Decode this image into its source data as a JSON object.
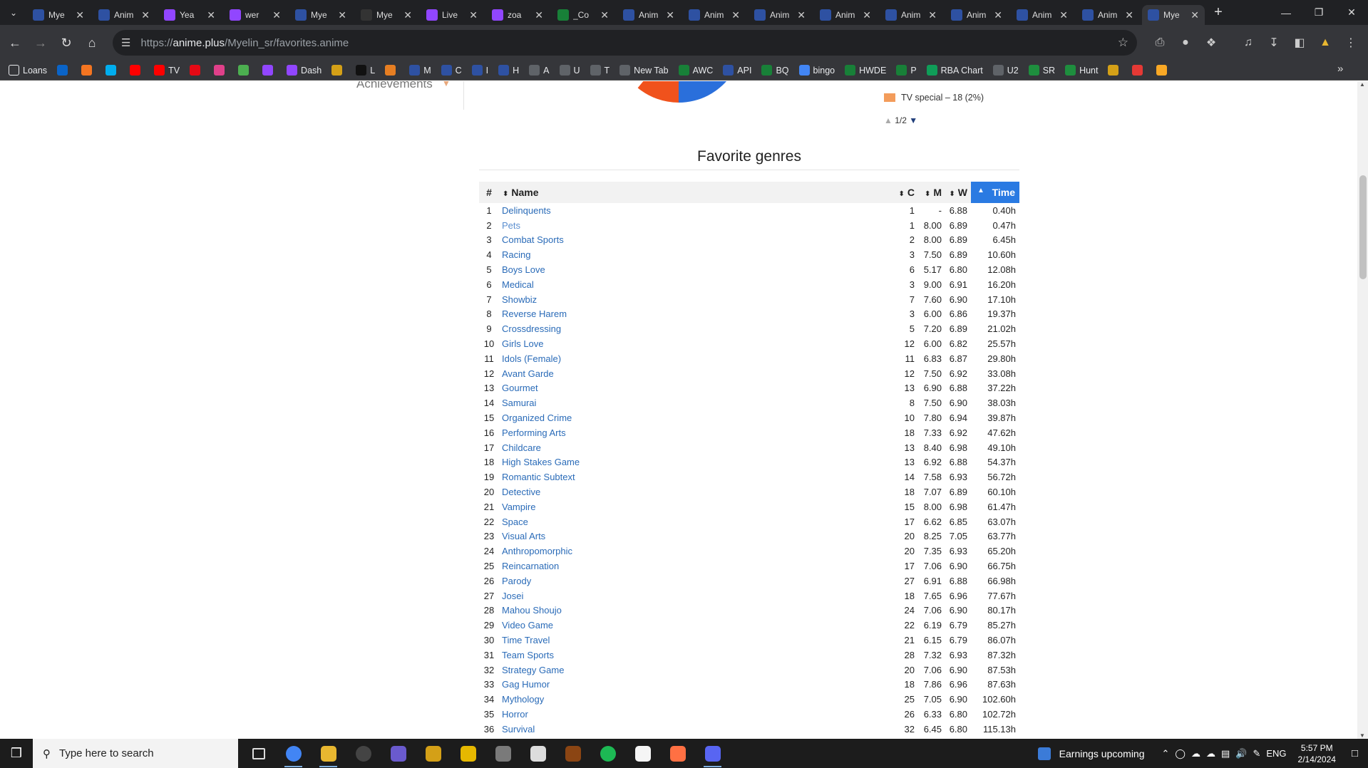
{
  "browser": {
    "tabs": [
      {
        "label": "Mye",
        "icon": "mal-icon",
        "color": "#2e51a2",
        "active": false
      },
      {
        "label": "Anim",
        "icon": "notify-icon",
        "color": "#2e51a2",
        "active": false
      },
      {
        "label": "Yea",
        "icon": "twitch-icon",
        "color": "#9146ff",
        "active": false
      },
      {
        "label": "wer",
        "icon": "twitch-icon",
        "color": "#9146ff",
        "active": false
      },
      {
        "label": "Mye",
        "icon": "mal-icon",
        "color": "#2e51a2",
        "active": false
      },
      {
        "label": "Mye",
        "icon": "anime-plus-icon",
        "color": "#333333",
        "active": false
      },
      {
        "label": "Live",
        "icon": "twitch-icon",
        "color": "#9146ff",
        "active": false
      },
      {
        "label": "zoa",
        "icon": "twitch-icon",
        "color": "#9146ff",
        "active": false
      },
      {
        "label": "_Co",
        "icon": "sheets-icon",
        "color": "#188038",
        "active": false
      },
      {
        "label": "Anim",
        "icon": "notify-icon",
        "color": "#2e51a2",
        "active": false
      },
      {
        "label": "Anim",
        "icon": "notify-icon",
        "color": "#2e51a2",
        "active": false
      },
      {
        "label": "Anim",
        "icon": "notify-icon",
        "color": "#2e51a2",
        "active": false
      },
      {
        "label": "Anim",
        "icon": "notify-icon",
        "color": "#2e51a2",
        "active": false
      },
      {
        "label": "Anim",
        "icon": "notify-icon",
        "color": "#2e51a2",
        "active": false
      },
      {
        "label": "Anim",
        "icon": "notify-icon",
        "color": "#2e51a2",
        "active": false
      },
      {
        "label": "Anim",
        "icon": "notify-icon",
        "color": "#2e51a2",
        "active": false
      },
      {
        "label": "Anim",
        "icon": "notify-icon",
        "color": "#2e51a2",
        "active": false
      },
      {
        "label": "Mye",
        "icon": "mal-icon",
        "color": "#2e51a2",
        "active": true
      }
    ],
    "url_prefix": "https://",
    "url_host": "anime.plus",
    "url_path": "/Myelin_sr/favorites.anime",
    "bookmarks": [
      {
        "label": "Loans",
        "icon": "folder-icon",
        "color": "#35363a"
      },
      {
        "label": "",
        "icon": "outlook-icon",
        "color": "#0a64c8"
      },
      {
        "label": "",
        "icon": "crunchyroll-icon",
        "color": "#f47521"
      },
      {
        "label": "",
        "icon": "hidive-icon",
        "color": "#00aeef"
      },
      {
        "label": "",
        "icon": "youtube-icon",
        "color": "#ff0000"
      },
      {
        "label": "TV",
        "icon": "youtube-tv-icon",
        "color": "#ff0000"
      },
      {
        "label": "",
        "icon": "netflix-icon",
        "color": "#e50914"
      },
      {
        "label": "",
        "icon": "bookmark-icon",
        "color": "#e0408a"
      },
      {
        "label": "",
        "icon": "bookmark-icon",
        "color": "#4caf50"
      },
      {
        "label": "",
        "icon": "twitch-icon",
        "color": "#9146ff"
      },
      {
        "label": "Dash",
        "icon": "twitch-icon",
        "color": "#9146ff"
      },
      {
        "label": "",
        "icon": "trophy-icon",
        "color": "#d4a017"
      },
      {
        "label": "L",
        "icon": "triangle-icon",
        "color": "#111111"
      },
      {
        "label": "",
        "icon": "bookmark-icon",
        "color": "#e67e22"
      },
      {
        "label": "M",
        "icon": "mal-icon",
        "color": "#2e51a2"
      },
      {
        "label": "C",
        "icon": "mal-icon",
        "color": "#2e51a2"
      },
      {
        "label": "I",
        "icon": "mal-icon",
        "color": "#2e51a2"
      },
      {
        "label": "H",
        "icon": "notify-icon",
        "color": "#2e51a2"
      },
      {
        "label": "A",
        "icon": "globe-icon",
        "color": "#5f6368"
      },
      {
        "label": "U",
        "icon": "globe-icon",
        "color": "#5f6368"
      },
      {
        "label": "T",
        "icon": "globe-icon",
        "color": "#5f6368"
      },
      {
        "label": "New Tab",
        "icon": "globe-icon",
        "color": "#5f6368"
      },
      {
        "label": "AWC",
        "icon": "sheets-icon",
        "color": "#188038"
      },
      {
        "label": "API",
        "icon": "mal-icon",
        "color": "#2e51a2"
      },
      {
        "label": "BQ",
        "icon": "sheets-icon",
        "color": "#188038"
      },
      {
        "label": "bingo",
        "icon": "docs-icon",
        "color": "#4285f4"
      },
      {
        "label": "HWDE",
        "icon": "sheets-icon",
        "color": "#188038"
      },
      {
        "label": "P",
        "icon": "sheets-icon",
        "color": "#188038"
      },
      {
        "label": "RBA Chart",
        "icon": "chart-icon",
        "color": "#0f9d58"
      },
      {
        "label": "U2",
        "icon": "globe-icon",
        "color": "#5f6368"
      },
      {
        "label": "SR",
        "icon": "drive-icon",
        "color": "#1e8e3e"
      },
      {
        "label": "Hunt",
        "icon": "drive-icon",
        "color": "#1e8e3e"
      },
      {
        "label": "",
        "icon": "bookmark-icon",
        "color": "#d4a017"
      },
      {
        "label": "",
        "icon": "bookmark-icon",
        "color": "#e53935"
      },
      {
        "label": "",
        "icon": "warning-icon",
        "color": "#f9a825"
      }
    ]
  },
  "page": {
    "sidebar_achievements": "Achievements",
    "legend_label": "TV special – 18 (2%)",
    "legend_color": "#f39c5b",
    "pager_text": "1/2",
    "pie_colors": [
      "#f0521c",
      "#2a6fdb"
    ],
    "section_title": "Favorite genres",
    "headers": {
      "rank": "#",
      "name": "Name",
      "count": "C",
      "mean": "M",
      "weighted": "W",
      "time": "Time"
    },
    "rows": [
      {
        "rank": "1",
        "name": "Delinquents",
        "c": "1",
        "m": "-",
        "w": "6.88",
        "t": "0.40h"
      },
      {
        "rank": "2",
        "name": "Pets",
        "c": "1",
        "m": "8.00",
        "w": "6.89",
        "t": "0.47h"
      },
      {
        "rank": "3",
        "name": "Combat Sports",
        "c": "2",
        "m": "8.00",
        "w": "6.89",
        "t": "6.45h"
      },
      {
        "rank": "4",
        "name": "Racing",
        "c": "3",
        "m": "7.50",
        "w": "6.89",
        "t": "10.60h"
      },
      {
        "rank": "5",
        "name": "Boys Love",
        "c": "6",
        "m": "5.17",
        "w": "6.80",
        "t": "12.08h"
      },
      {
        "rank": "6",
        "name": "Medical",
        "c": "3",
        "m": "9.00",
        "w": "6.91",
        "t": "16.20h"
      },
      {
        "rank": "7",
        "name": "Showbiz",
        "c": "7",
        "m": "7.60",
        "w": "6.90",
        "t": "17.10h"
      },
      {
        "rank": "8",
        "name": "Reverse Harem",
        "c": "3",
        "m": "6.00",
        "w": "6.86",
        "t": "19.37h"
      },
      {
        "rank": "9",
        "name": "Crossdressing",
        "c": "5",
        "m": "7.20",
        "w": "6.89",
        "t": "21.02h"
      },
      {
        "rank": "10",
        "name": "Girls Love",
        "c": "12",
        "m": "6.00",
        "w": "6.82",
        "t": "25.57h"
      },
      {
        "rank": "11",
        "name": "Idols (Female)",
        "c": "11",
        "m": "6.83",
        "w": "6.87",
        "t": "29.80h"
      },
      {
        "rank": "12",
        "name": "Avant Garde",
        "c": "12",
        "m": "7.50",
        "w": "6.92",
        "t": "33.08h"
      },
      {
        "rank": "13",
        "name": "Gourmet",
        "c": "13",
        "m": "6.90",
        "w": "6.88",
        "t": "37.22h"
      },
      {
        "rank": "14",
        "name": "Samurai",
        "c": "8",
        "m": "7.50",
        "w": "6.90",
        "t": "38.03h"
      },
      {
        "rank": "15",
        "name": "Organized Crime",
        "c": "10",
        "m": "7.80",
        "w": "6.94",
        "t": "39.87h"
      },
      {
        "rank": "16",
        "name": "Performing Arts",
        "c": "18",
        "m": "7.33",
        "w": "6.92",
        "t": "47.62h"
      },
      {
        "rank": "17",
        "name": "Childcare",
        "c": "13",
        "m": "8.40",
        "w": "6.98",
        "t": "49.10h"
      },
      {
        "rank": "18",
        "name": "High Stakes Game",
        "c": "13",
        "m": "6.92",
        "w": "6.88",
        "t": "54.37h"
      },
      {
        "rank": "19",
        "name": "Romantic Subtext",
        "c": "14",
        "m": "7.58",
        "w": "6.93",
        "t": "56.72h"
      },
      {
        "rank": "20",
        "name": "Detective",
        "c": "18",
        "m": "7.07",
        "w": "6.89",
        "t": "60.10h"
      },
      {
        "rank": "21",
        "name": "Vampire",
        "c": "15",
        "m": "8.00",
        "w": "6.98",
        "t": "61.47h"
      },
      {
        "rank": "22",
        "name": "Space",
        "c": "17",
        "m": "6.62",
        "w": "6.85",
        "t": "63.07h"
      },
      {
        "rank": "23",
        "name": "Visual Arts",
        "c": "20",
        "m": "8.25",
        "w": "7.05",
        "t": "63.77h"
      },
      {
        "rank": "24",
        "name": "Anthropomorphic",
        "c": "20",
        "m": "7.35",
        "w": "6.93",
        "t": "65.20h"
      },
      {
        "rank": "25",
        "name": "Reincarnation",
        "c": "17",
        "m": "7.06",
        "w": "6.90",
        "t": "66.75h"
      },
      {
        "rank": "26",
        "name": "Parody",
        "c": "27",
        "m": "6.91",
        "w": "6.88",
        "t": "66.98h"
      },
      {
        "rank": "27",
        "name": "Josei",
        "c": "18",
        "m": "7.65",
        "w": "6.96",
        "t": "77.67h"
      },
      {
        "rank": "28",
        "name": "Mahou Shoujo",
        "c": "24",
        "m": "7.06",
        "w": "6.90",
        "t": "80.17h"
      },
      {
        "rank": "29",
        "name": "Video Game",
        "c": "22",
        "m": "6.19",
        "w": "6.79",
        "t": "85.27h"
      },
      {
        "rank": "30",
        "name": "Time Travel",
        "c": "21",
        "m": "6.15",
        "w": "6.79",
        "t": "86.07h"
      },
      {
        "rank": "31",
        "name": "Team Sports",
        "c": "28",
        "m": "7.32",
        "w": "6.93",
        "t": "87.32h"
      },
      {
        "rank": "32",
        "name": "Strategy Game",
        "c": "20",
        "m": "7.06",
        "w": "6.90",
        "t": "87.53h"
      },
      {
        "rank": "33",
        "name": "Gag Humor",
        "c": "18",
        "m": "7.86",
        "w": "6.96",
        "t": "87.63h"
      },
      {
        "rank": "34",
        "name": "Mythology",
        "c": "25",
        "m": "7.05",
        "w": "6.90",
        "t": "102.60h"
      },
      {
        "rank": "35",
        "name": "Horror",
        "c": "26",
        "m": "6.33",
        "w": "6.80",
        "t": "102.72h"
      },
      {
        "rank": "36",
        "name": "Survival",
        "c": "32",
        "m": "6.45",
        "w": "6.80",
        "t": "115.13h"
      }
    ]
  },
  "taskbar": {
    "search_placeholder": "Type here to search",
    "apps": [
      {
        "icon": "task-view-icon",
        "color": "#1c1c1c",
        "running": false
      },
      {
        "icon": "chrome-icon",
        "color": "#4285f4",
        "running": true
      },
      {
        "icon": "file-explorer-icon",
        "color": "#e8b730",
        "running": true
      },
      {
        "icon": "obs-icon",
        "color": "#444444",
        "running": false
      },
      {
        "icon": "davinci-icon",
        "color": "#6a5acd",
        "running": false
      },
      {
        "icon": "game-icon",
        "color": "#d4a017",
        "running": false
      },
      {
        "icon": "sun-icon",
        "color": "#e6b800",
        "running": false
      },
      {
        "icon": "game-icon",
        "color": "#7a7a7a",
        "running": false
      },
      {
        "icon": "save-icon",
        "color": "#dddddd",
        "running": false
      },
      {
        "icon": "game-icon",
        "color": "#8b4513",
        "running": false
      },
      {
        "icon": "spotify-icon",
        "color": "#1db954",
        "running": false
      },
      {
        "icon": "file-icon",
        "color": "#f5f5f5",
        "running": false
      },
      {
        "icon": "app-icon",
        "color": "#ff7043",
        "running": false
      },
      {
        "icon": "discord-icon",
        "color": "#5865f2",
        "running": true
      }
    ],
    "news": "Earnings upcoming",
    "lang": "ENG",
    "time": "5:57 PM",
    "date": "2/14/2024"
  }
}
